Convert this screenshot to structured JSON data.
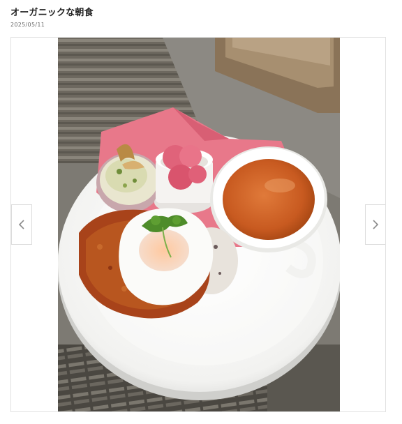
{
  "post": {
    "title": "オーガニックな朝食",
    "date": "2025/05/11"
  },
  "gallery": {
    "image_subject": "breakfast-plate-photo",
    "icons": {
      "prev": "chevron-left-icon",
      "next": "chevron-right-icon"
    }
  }
}
